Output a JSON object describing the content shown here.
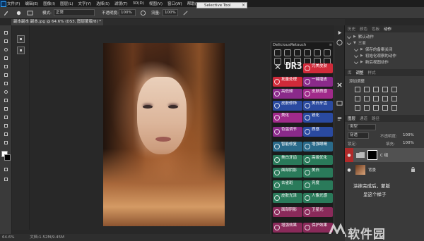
{
  "menubar": {
    "items": [
      "文件(F)",
      "编辑(E)",
      "图像(I)",
      "图层(L)",
      "文字(Y)",
      "选择(S)",
      "滤镜(T)",
      "3D(D)",
      "视图(V)",
      "窗口(W)",
      "帮助(H)"
    ]
  },
  "options": {
    "mode_label": "模式:",
    "mode_value": "正常",
    "opacity_label": "不透明度:",
    "opacity_value": "100%",
    "flow_label": "流量:",
    "flow_value": "100%"
  },
  "selective_tool": {
    "title": "Selective Tool"
  },
  "document": {
    "tab_title": "副本副本 副本.jpg @ 64.6% (DS3, 图层蒙版/8) *"
  },
  "plugin": {
    "title": "DeliciousRetouch",
    "logo": "DR3",
    "buttons": [
      {
        "label": "完美皮肤",
        "color": "#d02a3a"
      },
      {
        "label": "批量处理",
        "color": "#d02a3a"
      },
      {
        "label": "一键磨皮",
        "color": "#8a2a8a"
      },
      {
        "label": "高低频",
        "color": "#8a2a8a"
      },
      {
        "label": "皮肤质感",
        "color": "#a02a8a"
      },
      {
        "label": "皮肤修饰",
        "color": "#2a4aa0"
      },
      {
        "label": "美白牙齿",
        "color": "#2a4aa0"
      },
      {
        "label": "美化",
        "color": "#a02a8a"
      },
      {
        "label": "色温调节",
        "color": "#8a2a8a"
      },
      {
        "label": "质感",
        "color": "#2a4aa0"
      },
      {
        "label": "锐化",
        "color": "#2a4aa0"
      },
      {
        "label": "智能修复",
        "color": "#2a6a8a"
      },
      {
        "label": "增强眼睛",
        "color": "#2a6a8a"
      },
      {
        "label": "美白牙齿",
        "color": "#2a7a5a"
      },
      {
        "label": "高级优化",
        "color": "#2a7a5a"
      },
      {
        "label": "面部阴影",
        "color": "#2a7a5a"
      },
      {
        "label": "美白",
        "color": "#2a7a5a"
      },
      {
        "label": "去雀斑",
        "color": "#2a7a5a"
      },
      {
        "label": "亮度",
        "color": "#2a7a5a"
      },
      {
        "label": "皮肤光泽",
        "color": "#2a7a5a"
      },
      {
        "label": "人像光感",
        "color": "#2a7a5a"
      },
      {
        "label": "面部阴影",
        "color": "#8a2a5a"
      },
      {
        "label": "卫星光",
        "color": "#8a2a5a"
      },
      {
        "label": "增强效果",
        "color": "#8a2a5a"
      },
      {
        "label": "保护效果",
        "color": "#8a2a5a"
      }
    ]
  },
  "panels": {
    "top_tabs": [
      "历史",
      "颜色",
      "色板",
      "动作"
    ],
    "actions": [
      {
        "label": "默认动作",
        "tri": "▶"
      },
      {
        "label": "三亚",
        "tri": "▼"
      },
      {
        "label": "保存的备案关闭",
        "tri": "▶"
      },
      {
        "label": "初始化观察的动作",
        "tri": "▶"
      },
      {
        "label": "新后视图动作",
        "tri": "▶"
      }
    ],
    "mid_tabs": [
      "库",
      "调整",
      "样式"
    ],
    "adjust_title": "添加调整",
    "layer_tabs": [
      "图层",
      "通道",
      "路径"
    ],
    "kind_label": "类型",
    "blend_mode": "穿透",
    "opacity_label": "不透明度:",
    "opacity_value": "100%",
    "lock_label": "锁定:",
    "fill_label": "填充:",
    "fill_value": "100%",
    "layers": [
      {
        "name": "C 组",
        "type": "group"
      },
      {
        "name": "背景",
        "type": "image"
      }
    ]
  },
  "annotation": {
    "line1": "涂抹完成后，蒙版",
    "line2": "呈这个样子"
  },
  "watermark": {
    "text": "软件园"
  },
  "status": {
    "zoom": "64.6%",
    "doc": "文档:1.52M/9.45M"
  }
}
